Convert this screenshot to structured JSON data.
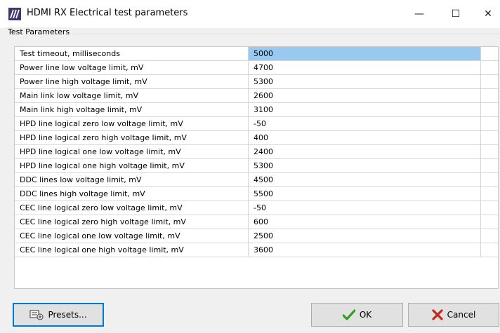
{
  "window": {
    "title": "HDMI RX Electrical test parameters",
    "app_icon": "hdmi-slashes-icon",
    "minimize_glyph": "—",
    "maximize_glyph": "☐",
    "close_glyph": "✕"
  },
  "group": {
    "label": "Test Parameters"
  },
  "parameters": [
    {
      "name": "Test timeout, milliseconds",
      "value": "5000"
    },
    {
      "name": "Power line low voltage limit, mV",
      "value": "4700"
    },
    {
      "name": "Power line high voltage limit, mV",
      "value": "5300"
    },
    {
      "name": "Main link low voltage limit, mV",
      "value": "2600"
    },
    {
      "name": "Main link high voltage limit, mV",
      "value": "3100"
    },
    {
      "name": "HPD line logical zero low voltage limit, mV",
      "value": "-50"
    },
    {
      "name": "HPD line logical zero high voltage limit, mV",
      "value": "400"
    },
    {
      "name": "HPD line logical one low voltage limit, mV",
      "value": "2400"
    },
    {
      "name": "HPD line logical one high voltage limit, mV",
      "value": "5300"
    },
    {
      "name": "DDC lines low voltage limit, mV",
      "value": "4500"
    },
    {
      "name": "DDC lines high voltage limit, mV",
      "value": "5500"
    },
    {
      "name": "CEC line logical zero low voltage limit, mV",
      "value": "-50"
    },
    {
      "name": "CEC line logical zero high voltage limit, mV",
      "value": "600"
    },
    {
      "name": "CEC line logical one low voltage limit, mV",
      "value": "2500"
    },
    {
      "name": "CEC line logical one high voltage limit, mV",
      "value": "3600"
    }
  ],
  "selected_row": 0,
  "buttons": {
    "presets_label": "Presets...",
    "ok_label": "OK",
    "cancel_label": "Cancel"
  },
  "colors": {
    "selection": "#99c9ef",
    "ok_check": "#2e9e1f",
    "cancel_x": "#c8261d",
    "focus_border": "#0078d7"
  }
}
